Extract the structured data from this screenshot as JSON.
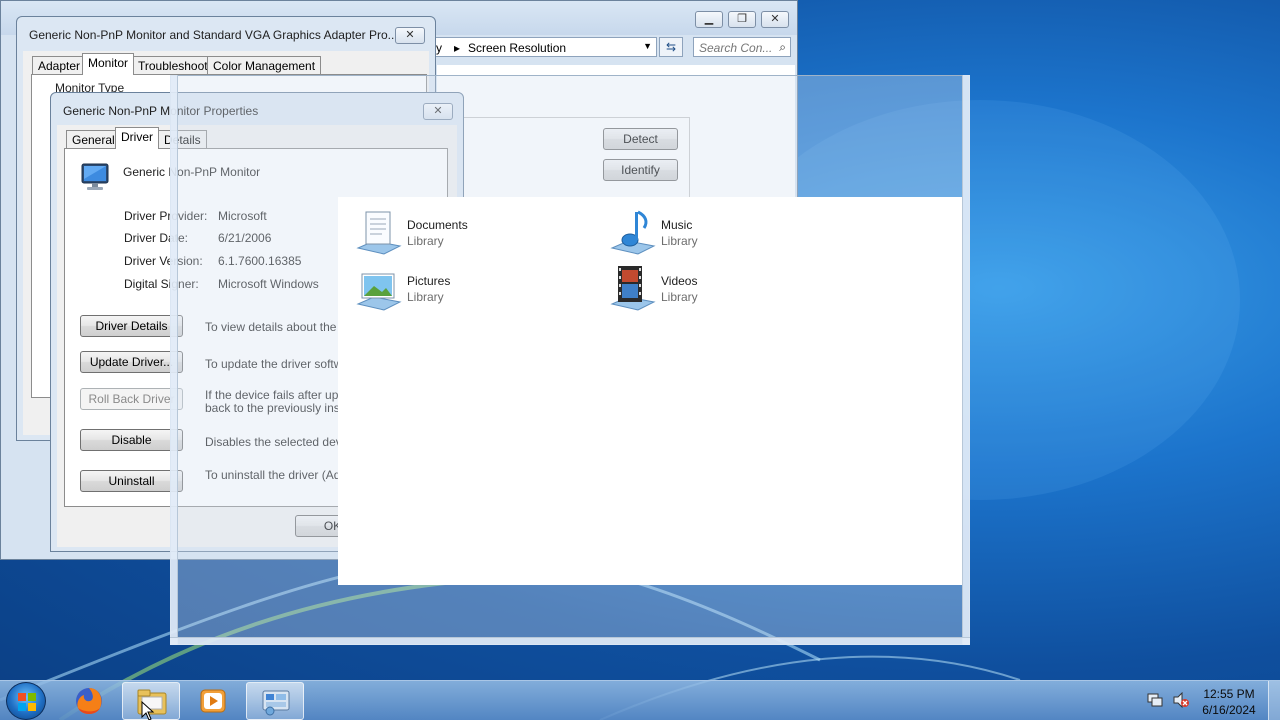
{
  "explorer_window": {
    "address_parts": [
      "y",
      "Screen Resolution"
    ],
    "search_placeholder": "Search Con...",
    "buttons": {
      "detect": "Detect",
      "identify": "Identify"
    }
  },
  "adapter_dialog": {
    "title": "Generic Non-PnP Monitor and Standard VGA Graphics Adapter Pro...",
    "tabs": [
      "Adapter",
      "Monitor",
      "Troubleshoot",
      "Color Management"
    ],
    "active_tab": "Monitor",
    "group_label": "Monitor Type"
  },
  "monitor_dialog": {
    "title": "Generic Non-PnP Monitor Properties",
    "tabs": [
      "General",
      "Driver",
      "Details"
    ],
    "active_tab": "Driver",
    "device_name": "Generic Non-PnP Monitor",
    "fields": [
      {
        "label": "Driver Provider:",
        "value": "Microsoft"
      },
      {
        "label": "Driver Date:",
        "value": "6/21/2006"
      },
      {
        "label": "Driver Version:",
        "value": "6.1.7600.16385"
      },
      {
        "label": "Digital Signer:",
        "value": "Microsoft Windows"
      }
    ],
    "actions": [
      {
        "button": "Driver Details",
        "desc": "To view details about the dri",
        "disabled": false
      },
      {
        "button": "Update Driver...",
        "desc": "To update the driver softwar",
        "disabled": false
      },
      {
        "button": "Roll Back Driver",
        "desc": "If the device fails after updat",
        "desc2": "back to the previously install",
        "disabled": true
      },
      {
        "button": "Disable",
        "desc": "Disables the selected device",
        "disabled": false
      },
      {
        "button": "Uninstall",
        "desc": "To uninstall the driver (Adva",
        "disabled": false
      }
    ],
    "ok_button": "OK"
  },
  "libraries": [
    {
      "name": "Documents",
      "type": "Library",
      "icon": "documents-library-icon"
    },
    {
      "name": "Music",
      "type": "Library",
      "icon": "music-library-icon"
    },
    {
      "name": "Pictures",
      "type": "Library",
      "icon": "pictures-library-icon"
    },
    {
      "name": "Videos",
      "type": "Library",
      "icon": "videos-library-icon"
    }
  ],
  "taskbar": {
    "apps": [
      "start-orb",
      "firefox-icon",
      "explorer-icon",
      "media-player-icon",
      "control-panel-icon"
    ],
    "time": "12:55 PM",
    "date": "6/16/2024"
  }
}
